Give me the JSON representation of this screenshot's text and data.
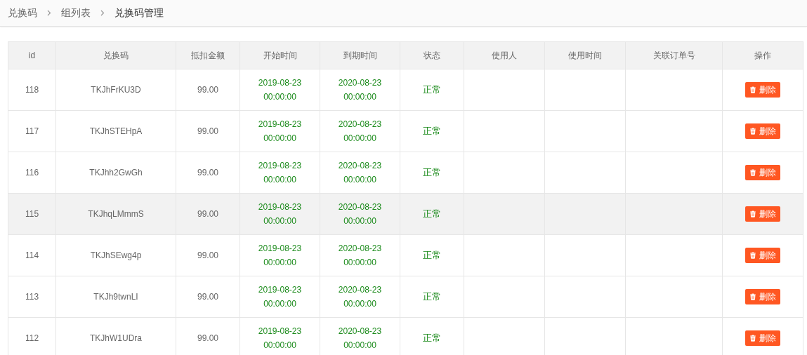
{
  "breadcrumb": [
    {
      "label": "兑换码",
      "current": false
    },
    {
      "label": "组列表",
      "current": false
    },
    {
      "label": "兑换码管理",
      "current": true
    }
  ],
  "table": {
    "columns": [
      "id",
      "兑换码",
      "抵扣金额",
      "开始时间",
      "到期时间",
      "状态",
      "使用人",
      "使用时间",
      "关联订单号",
      "操作"
    ],
    "rows": [
      {
        "id": "118",
        "code": "TKJhFrKU3D",
        "amount": "99.00",
        "start": [
          "2019-08-23",
          "00:00:00"
        ],
        "end": [
          "2020-08-23",
          "00:00:00"
        ],
        "status": "正常",
        "kind": "normal",
        "highlighted": false,
        "action": "删除"
      },
      {
        "id": "117",
        "code": "TKJhSTEHpA",
        "amount": "99.00",
        "start": [
          "2019-08-23",
          "00:00:00"
        ],
        "end": [
          "2020-08-23",
          "00:00:00"
        ],
        "status": "正常",
        "kind": "normal",
        "highlighted": false,
        "action": "删除"
      },
      {
        "id": "116",
        "code": "TKJhh2GwGh",
        "amount": "99.00",
        "start": [
          "2019-08-23",
          "00:00:00"
        ],
        "end": [
          "2020-08-23",
          "00:00:00"
        ],
        "status": "正常",
        "kind": "normal",
        "highlighted": false,
        "action": "删除"
      },
      {
        "id": "115",
        "code": "TKJhqLMmmS",
        "amount": "99.00",
        "start": [
          "2019-08-23",
          "00:00:00"
        ],
        "end": [
          "2020-08-23",
          "00:00:00"
        ],
        "status": "正常",
        "kind": "normal",
        "highlighted": true,
        "action": "删除"
      },
      {
        "id": "114",
        "code": "TKJhSEwg4p",
        "amount": "99.00",
        "start": [
          "2019-08-23",
          "00:00:00"
        ],
        "end": [
          "2020-08-23",
          "00:00:00"
        ],
        "status": "正常",
        "kind": "normal",
        "highlighted": false,
        "action": "删除"
      },
      {
        "id": "113",
        "code": "TKJh9twnLI",
        "amount": "99.00",
        "start": [
          "2019-08-23",
          "00:00:00"
        ],
        "end": [
          "2020-08-23",
          "00:00:00"
        ],
        "status": "正常",
        "kind": "normal",
        "highlighted": false,
        "action": "删除"
      },
      {
        "id": "112",
        "code": "TKJhW1UDra",
        "amount": "99.00",
        "start": [
          "2019-08-23",
          "00:00:00"
        ],
        "end": [
          "2020-08-23",
          "00:00:00"
        ],
        "status": "正常",
        "kind": "normal",
        "highlighted": false,
        "action": "删除"
      }
    ]
  }
}
